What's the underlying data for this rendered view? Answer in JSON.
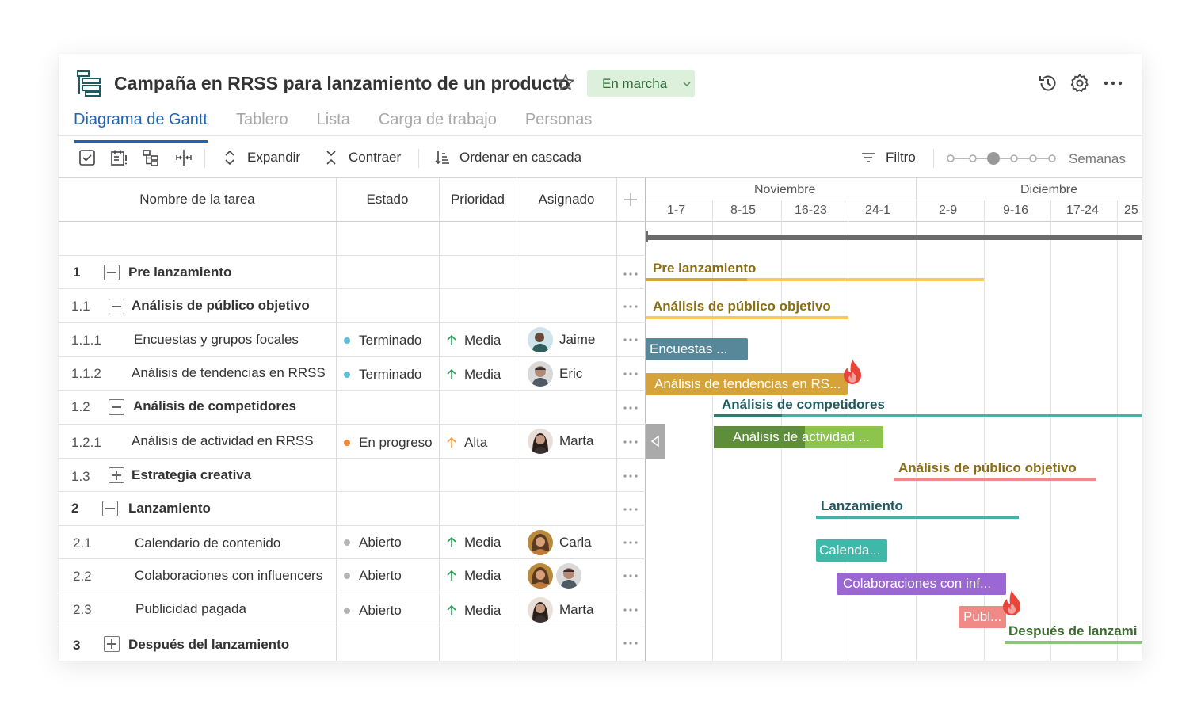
{
  "project": {
    "title": "Campaña en RRSS para lanzamiento de un producto",
    "status": "En marcha",
    "colors": {
      "accent": "#1e64b4",
      "status_bg": "#dcf0db",
      "status_text": "#2e6b36"
    }
  },
  "header_icons": [
    "history-icon",
    "settings-icon",
    "more-icon"
  ],
  "tabs": [
    {
      "label": "Diagrama de Gantt",
      "active": true
    },
    {
      "label": "Tablero",
      "active": false
    },
    {
      "label": "Lista",
      "active": false
    },
    {
      "label": "Carga de trabajo",
      "active": false
    },
    {
      "label": "Personas",
      "active": false
    }
  ],
  "toolbar": {
    "expand_label": "Expandir",
    "collapse_label": "Contraer",
    "cascade_label": "Ordenar en cascada",
    "filter_label": "Filtro",
    "zoom_label": "Semanas"
  },
  "columns": {
    "task": "Nombre de la tarea",
    "status": "Estado",
    "priority": "Prioridad",
    "assignee": "Asignado"
  },
  "rows": [
    {
      "num": "1",
      "name": "Pre lanzamiento",
      "level": 0,
      "group": true,
      "toggle": "minus"
    },
    {
      "num": "1.1",
      "name": "Análisis de público objetivo",
      "level": 1,
      "group": true,
      "toggle": "minus"
    },
    {
      "num": "1.1.1",
      "name": "Encuestas y grupos focales",
      "level": 2,
      "status": "Terminado",
      "status_color": "#5bc0d3",
      "priority": "Media",
      "priority_color": "#2a9d57",
      "assignees": [
        "Jaime"
      ]
    },
    {
      "num": "1.1.2",
      "name": "Análisis de tendencias en RRSS",
      "level": 2,
      "status": "Terminado",
      "status_color": "#5bc0d3",
      "priority": "Media",
      "priority_color": "#2a9d57",
      "assignees": [
        "Eric"
      ]
    },
    {
      "num": "1.2",
      "name": "Análisis de competidores",
      "level": 1,
      "group": true,
      "toggle": "minus"
    },
    {
      "num": "1.2.1",
      "name": "Análisis de actividad en RRSS",
      "level": 2,
      "status": "En progreso",
      "status_color": "#f0883a",
      "priority": "Alta",
      "priority_color": "#f0a040",
      "assignees": [
        "Marta"
      ]
    },
    {
      "num": "1.3",
      "name": "Estrategia creativa",
      "level": 1,
      "group": true,
      "toggle": "plus"
    },
    {
      "num": "2",
      "name": "Lanzamiento",
      "level": 0,
      "group": true,
      "toggle": "minus"
    },
    {
      "num": "2.1",
      "name": "Calendario de contenido",
      "level": 2,
      "status": "Abierto",
      "status_color": "#b5b5b5",
      "priority": "Media",
      "priority_color": "#2a9d57",
      "assignees": [
        "Carla"
      ]
    },
    {
      "num": "2.2",
      "name": "Colaboraciones con influencers",
      "level": 2,
      "status": "Abierto",
      "status_color": "#b5b5b5",
      "priority": "Media",
      "priority_color": "#2a9d57",
      "assignees": []
    },
    {
      "num": "2.3",
      "name": "Publicidad pagada",
      "level": 2,
      "status": "Abierto",
      "status_color": "#b5b5b5",
      "priority": "Media",
      "priority_color": "#2a9d57",
      "assignees": [
        "Marta"
      ]
    },
    {
      "num": "3",
      "name": "Después del lanzamiento",
      "level": 0,
      "group": true,
      "toggle": "plus"
    }
  ],
  "timeline": {
    "months": [
      "Noviembre",
      "Diciembre"
    ],
    "weeks": [
      "1-7",
      "8-15",
      "16-23",
      "24-1",
      "2-9",
      "9-16",
      "17-24",
      "25"
    ]
  },
  "gantt_items": [
    {
      "label": "Pre lanzamiento",
      "kind": "summary",
      "text_color": "#8a6d12",
      "line_color": "#f6c95a",
      "progress_color": "#d4a33a"
    },
    {
      "label": "Análisis de público objetivo",
      "kind": "summary",
      "text_color": "#8a6d12",
      "line_color": "#f6c95a"
    },
    {
      "label": "Encuestas ...",
      "kind": "bar",
      "color": "#56889a"
    },
    {
      "label": "Análisis de tendencias en RS...",
      "kind": "bar",
      "color": "#d6a33b",
      "flame": true
    },
    {
      "label": "Análisis de  competidores",
      "kind": "summary",
      "text_color": "#1f5a5e",
      "line_color": "#44b3a6",
      "progress_color": "#2e7d71"
    },
    {
      "label": "Análisis de actividad ...",
      "kind": "bar",
      "color": "#8cc44e",
      "progress_color": "#5f8e3b"
    },
    {
      "label": "Análisis de público objetivo",
      "kind": "summary",
      "text_color": "#8a6d12",
      "line_color": "#f08a8a"
    },
    {
      "label": "Lanzamiento",
      "kind": "summary",
      "text_color": "#1f5a5e",
      "line_color": "#44b3a6"
    },
    {
      "label": "Calenda...",
      "kind": "bar",
      "color": "#3fb8a9"
    },
    {
      "label": "Colaboraciones con inf...",
      "kind": "bar",
      "color": "#9a67d4"
    },
    {
      "label": "Publ...",
      "kind": "bar",
      "color": "#ef8a86",
      "flame": true
    },
    {
      "label": "Después de lanzami",
      "kind": "summary",
      "text_color": "#3b6b2e",
      "line_color": "#8cc47a"
    }
  ]
}
